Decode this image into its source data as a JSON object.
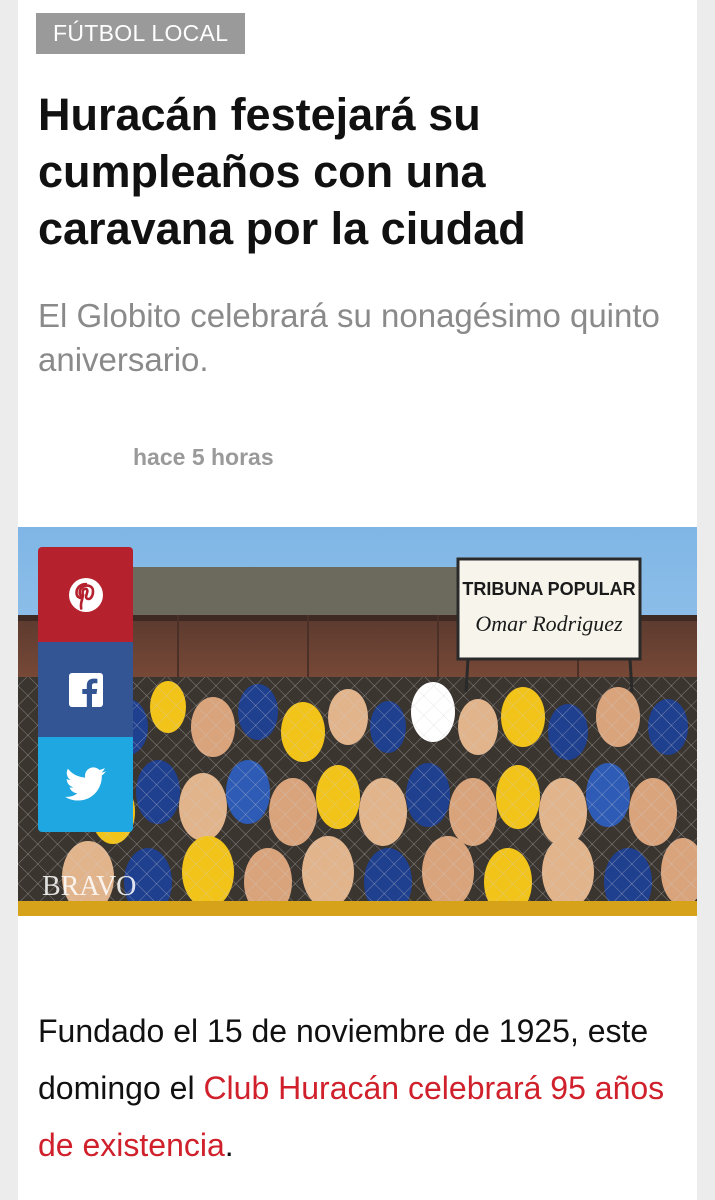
{
  "article": {
    "category": "FÚTBOL LOCAL",
    "headline": "Huracán festejará su cumpleaños con una caravana por la ciudad",
    "subtitle": "El Globito celebrará su nonagésimo quinto aniversario.",
    "timestamp": "hace 5 horas",
    "photo": {
      "banner_line1": "TRIBUNA POPULAR",
      "banner_line2": "Omar Rodriguez",
      "watermark": "BRAVO"
    },
    "share": {
      "pinterest_icon": "pinterest-icon",
      "facebook_icon": "facebook-icon",
      "twitter_icon": "twitter-icon"
    },
    "body": {
      "text_before": "Fundado el 15 de noviembre de 1925, este domingo el ",
      "link_text": "Club Huracán celebrará 95 años de existencia",
      "text_after": "."
    }
  },
  "colors": {
    "link": "#d0202b",
    "pinterest": "#b5222e",
    "facebook": "#335593",
    "twitter": "#1ea7e0",
    "category_bg": "#9a9a9a"
  }
}
